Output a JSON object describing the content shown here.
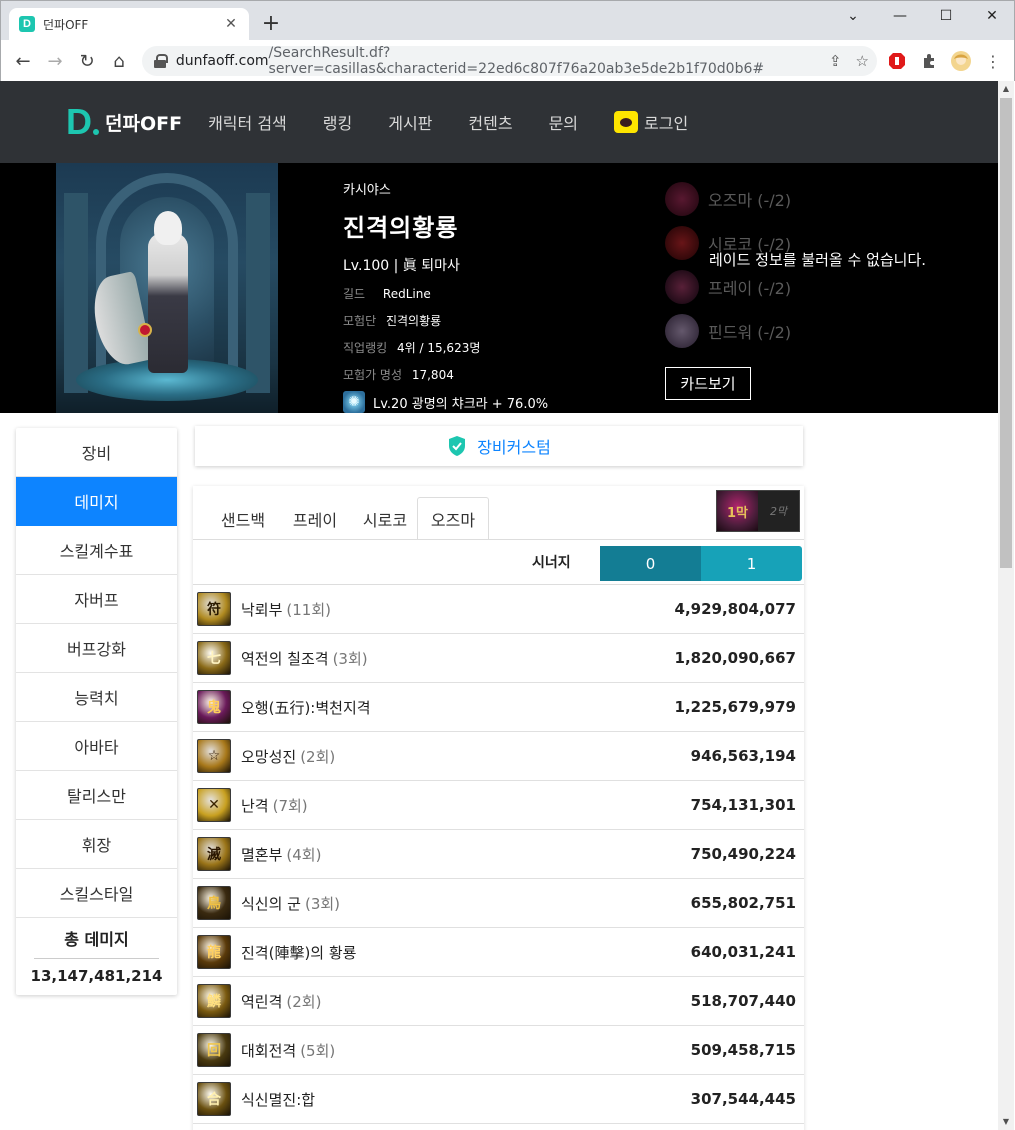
{
  "browser": {
    "tab_title": "던파OFF",
    "tab_favicon": "D",
    "url_host": "dunfaoff.com",
    "url_rest": "/SearchResult.df?server=casillas&characterid=22ed6c807f76a20ab3e5de2b1f70d0b6#"
  },
  "nav": {
    "logo_letter": "D",
    "logo_text": "던파OFF",
    "items": [
      "캐릭터 검색",
      "랭킹",
      "게시판",
      "컨텐츠",
      "문의"
    ],
    "login": "로그인"
  },
  "character": {
    "server": "카시야스",
    "name": "진격의황룡",
    "job": "Lv.100 | 眞 퇴마사",
    "guild_label": "길드",
    "guild": "RedLine",
    "party_label": "모험단",
    "party": "진격의황룡",
    "rank_label": "직업랭킹",
    "rank": "4위 / 15,623명",
    "fame_label": "모험가 명성",
    "fame": "17,804",
    "chakra": "Lv.20 광명의 챠크라 + 76.0%"
  },
  "raids": {
    "items": [
      {
        "name": "오즈마 (-/2)",
        "color": "#5a1230"
      },
      {
        "name": "시로코 (-/2)",
        "color": "#6a1014"
      },
      {
        "name": "프레이 (-/2)",
        "color": "#3a1438"
      },
      {
        "name": "핀드워 (-/2)",
        "color": "#5c4a6a"
      }
    ],
    "message": "레이드 정보를 불러올 수 없습니다.",
    "card_button": "카드보기"
  },
  "sidebar": {
    "items": [
      "장비",
      "데미지",
      "스킬계수표",
      "자버프",
      "버프강화",
      "능력치",
      "아바타",
      "탈리스만",
      "휘장",
      "스킬스타일"
    ],
    "active_index": 1,
    "total_label": "총 데미지",
    "total_value": "13,147,481,214"
  },
  "custom": {
    "label": "장비커스텀"
  },
  "damage_tabs": {
    "tabs": [
      "샌드백",
      "프레이",
      "시로코",
      "오즈마"
    ],
    "active": "오즈마",
    "thumb_a": "1막",
    "thumb_b": "2막"
  },
  "synergy": {
    "label": "시너지",
    "options": [
      {
        "label": "0",
        "color": "#137d94"
      },
      {
        "label": "1",
        "color": "#17a2b8"
      }
    ]
  },
  "skills": [
    {
      "name": "낙뢰부",
      "count": "(11회)",
      "damage": "4,929,804,077",
      "glyph": "符",
      "bg": "#b08a20",
      "fg": "#2a1a00"
    },
    {
      "name": "역전의 칠조격",
      "count": "(3회)",
      "damage": "1,820,090,667",
      "glyph": "七",
      "bg": "#8a6a18",
      "fg": "#fff3c0"
    },
    {
      "name": "오행(五行):벽천지격",
      "count": "",
      "damage": "1,225,679,979",
      "glyph": "鬼",
      "bg": "#6a1a5a",
      "fg": "#ffcf5a"
    },
    {
      "name": "오망성진",
      "count": "(2회)",
      "damage": "946,563,194",
      "glyph": "☆",
      "bg": "#a8781a",
      "fg": "#2a1400"
    },
    {
      "name": "난격",
      "count": "(7회)",
      "damage": "754,131,301",
      "glyph": "✕",
      "bg": "#c8a020",
      "fg": "#3a2400"
    },
    {
      "name": "멸혼부",
      "count": "(4회)",
      "damage": "750,490,224",
      "glyph": "滅",
      "bg": "#9a7418",
      "fg": "#2a1600"
    },
    {
      "name": "식신의 군",
      "count": "(3회)",
      "damage": "655,802,751",
      "glyph": "鳥",
      "bg": "#3a2a10",
      "fg": "#f0c040"
    },
    {
      "name": "진격(陣擊)의 황룡",
      "count": "",
      "damage": "640,031,241",
      "glyph": "龍",
      "bg": "#5a3a0a",
      "fg": "#ffd060"
    },
    {
      "name": "역린격",
      "count": "(2회)",
      "damage": "518,707,440",
      "glyph": "鱗",
      "bg": "#7a5a10",
      "fg": "#ffe080"
    },
    {
      "name": "대회전격",
      "count": "(5회)",
      "damage": "509,458,715",
      "glyph": "回",
      "bg": "#4a3a10",
      "fg": "#f0c850"
    },
    {
      "name": "식신멸진:합",
      "count": "",
      "damage": "307,544,445",
      "glyph": "合",
      "bg": "#6a5010",
      "fg": "#fff0b0"
    }
  ]
}
